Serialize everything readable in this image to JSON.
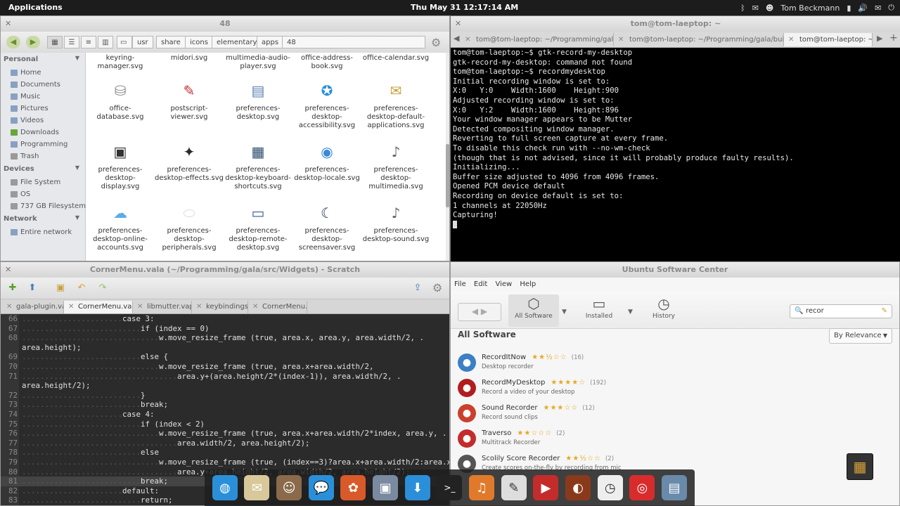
{
  "panel": {
    "apps": "Applications",
    "clock": "Thu May 31 12:17:14 AM",
    "user": "Tom Beckmann"
  },
  "file_manager": {
    "title": "48",
    "breadcrumb": [
      "usr",
      "share",
      "icons",
      "elementary",
      "apps",
      "48"
    ],
    "sidebar": {
      "personal": "Personal",
      "personal_items": [
        "Home",
        "Documents",
        "Music",
        "Pictures",
        "Videos",
        "Downloads",
        "Programming",
        "Trash"
      ],
      "devices": "Devices",
      "device_items": [
        "File System",
        "OS",
        "737 GB Filesystem"
      ],
      "network": "Network",
      "network_items": [
        "Entire network"
      ]
    },
    "files_row0": [
      "keyring-manager.svg",
      "midori.svg",
      "multimedia-audio-player.svg",
      "office-address-book.svg",
      "office-calendar.svg"
    ],
    "files": [
      "office-database.svg",
      "postscript-viewer.svg",
      "preferences-desktop.svg",
      "preferences-desktop-accessibility.svg",
      "preferences-desktop-default-applications.svg",
      "preferences-desktop-display.svg",
      "preferences-desktop-effects.svg",
      "preferences-desktop-keyboard-shortcuts.svg",
      "preferences-desktop-locale.svg",
      "preferences-desktop-multimedia.svg",
      "preferences-desktop-online-accounts.svg",
      "preferences-desktop-peripherals.svg",
      "preferences-desktop-remote-desktop.svg",
      "preferences-desktop-screensaver.svg",
      "preferences-desktop-sound.svg"
    ]
  },
  "terminal": {
    "title": "tom@tom-laeptop: ~",
    "tabs": [
      "tom@tom-laeptop: ~/Programming/gala/build",
      "tom@tom-laeptop: ~/Programming/gala/build",
      "tom@tom-laeptop: ~"
    ],
    "lines": [
      "tom@tom-laeptop:~$ gtk-record-my-desktop",
      "gtk-record-my-desktop: command not found",
      "tom@tom-laeptop:~$ recordmydesktop",
      "Initial recording window is set to:",
      "X:0   Y:0    Width:1600    Height:900",
      "Adjusted recording window is set to:",
      "X:0   Y:2    Width:1600    Height:896",
      "Your window manager appears to be Mutter",
      "",
      "",
      "Detected compositing window manager.",
      "Reverting to full screen capture at every frame.",
      "To disable this check run with --no-wm-check",
      "(though that is not advised, since it will probably produce faulty results).",
      "",
      "Initializing...",
      "Buffer size adjusted to 4096 from 4096 frames.",
      "Opened PCM device default",
      "Recording on device default is set to:",
      "1 channels at 22050Hz",
      "Capturing!"
    ]
  },
  "editor": {
    "title": "CornerMenu.vala (~/Programming/gala/src/Widgets) - Scratch",
    "tabs": [
      "gala-plugin.vala",
      "CornerMenu.vala",
      "libmutter.vapi",
      "keybindings.c",
      "CornerMenu.c"
    ],
    "lines": [
      {
        "n": "66",
        "dots": "......................",
        "code": "case 3:"
      },
      {
        "n": "67",
        "dots": "..........................",
        "code": "if (index == 0)"
      },
      {
        "n": "68",
        "dots": "..............................",
        "code": "w.move_resize_frame (true, area.x, area.y, area.width/2, ."
      },
      {
        "n": "",
        "dots": "",
        "code": "area.height);"
      },
      {
        "n": "69",
        "dots": "..........................",
        "code": "else {"
      },
      {
        "n": "70",
        "dots": "..............................",
        "code": "w.move_resize_frame (true, area.x+area.width/2,"
      },
      {
        "n": "71",
        "dots": "..................................",
        "code": "area.y+(area.height/2*(index-1)), area.width/2, ."
      },
      {
        "n": "",
        "dots": "",
        "code": "area.height/2);"
      },
      {
        "n": "72",
        "dots": "..........................",
        "code": "}"
      },
      {
        "n": "73",
        "dots": "..........................",
        "code": "break;"
      },
      {
        "n": "74",
        "dots": "......................",
        "code": "case 4:"
      },
      {
        "n": "75",
        "dots": "..........................",
        "code": "if (index < 2)"
      },
      {
        "n": "76",
        "dots": "..............................",
        "code": "w.move_resize_frame (true, area.x+area.width/2*index, area.y, ."
      },
      {
        "n": "77",
        "dots": "..................................",
        "code": "area.width/2, area.height/2);"
      },
      {
        "n": "78",
        "dots": "..........................",
        "code": "else"
      },
      {
        "n": "79",
        "dots": "..............................",
        "code": "w.move_resize_frame (true, (index==3)?area.x+area.width/2:area.x,"
      },
      {
        "n": "80",
        "dots": "..................................",
        "code": "area.y+area.height/2, area.width/2, area.height/2);"
      },
      {
        "n": "81",
        "dots": "..........................",
        "code": "break;"
      },
      {
        "n": "82",
        "dots": "......................",
        "code": "default:"
      },
      {
        "n": "83",
        "dots": "..........................",
        "code": "return;"
      }
    ]
  },
  "software_center": {
    "title": "Ubuntu Software Center",
    "menu": [
      "File",
      "Edit",
      "View",
      "Help"
    ],
    "toolbar": {
      "all": "All Software",
      "installed": "Installed",
      "history": "History"
    },
    "search_value": "recor",
    "heading": "All Software",
    "sort": "By Relevance",
    "apps": [
      {
        "name": "RecordItNow",
        "desc": "Desktop recorder",
        "stars": "★★½☆☆",
        "count": "(16)",
        "color": "#3b7fc4"
      },
      {
        "name": "RecordMyDesktop",
        "desc": "Record a video of your desktop",
        "stars": "★★★★☆",
        "count": "(192)",
        "color": "#b01e1e"
      },
      {
        "name": "Sound Recorder",
        "desc": "Record sound clips",
        "stars": "★★★☆☆",
        "count": "(12)",
        "color": "#c9402d"
      },
      {
        "name": "Traverso",
        "desc": "Multitrack Recorder",
        "stars": "★★☆☆☆",
        "count": "(2)",
        "color": "#c42c2c"
      },
      {
        "name": "Scolily Score Recorder",
        "desc": "Create scores on-the-fly by recording from mic",
        "stars": "★★½☆☆",
        "count": "(2)",
        "color": "#555555"
      }
    ]
  },
  "dock": [
    "web-browser-icon",
    "mail-icon",
    "contacts-icon",
    "chat-icon",
    "photos-icon",
    "preferences-icon",
    "download-icon",
    "terminal-icon",
    "music-icon",
    "text-editor-icon",
    "screen-recorder-icon",
    "globe-icon",
    "clock-icon",
    "target-icon",
    "folder-icon"
  ]
}
